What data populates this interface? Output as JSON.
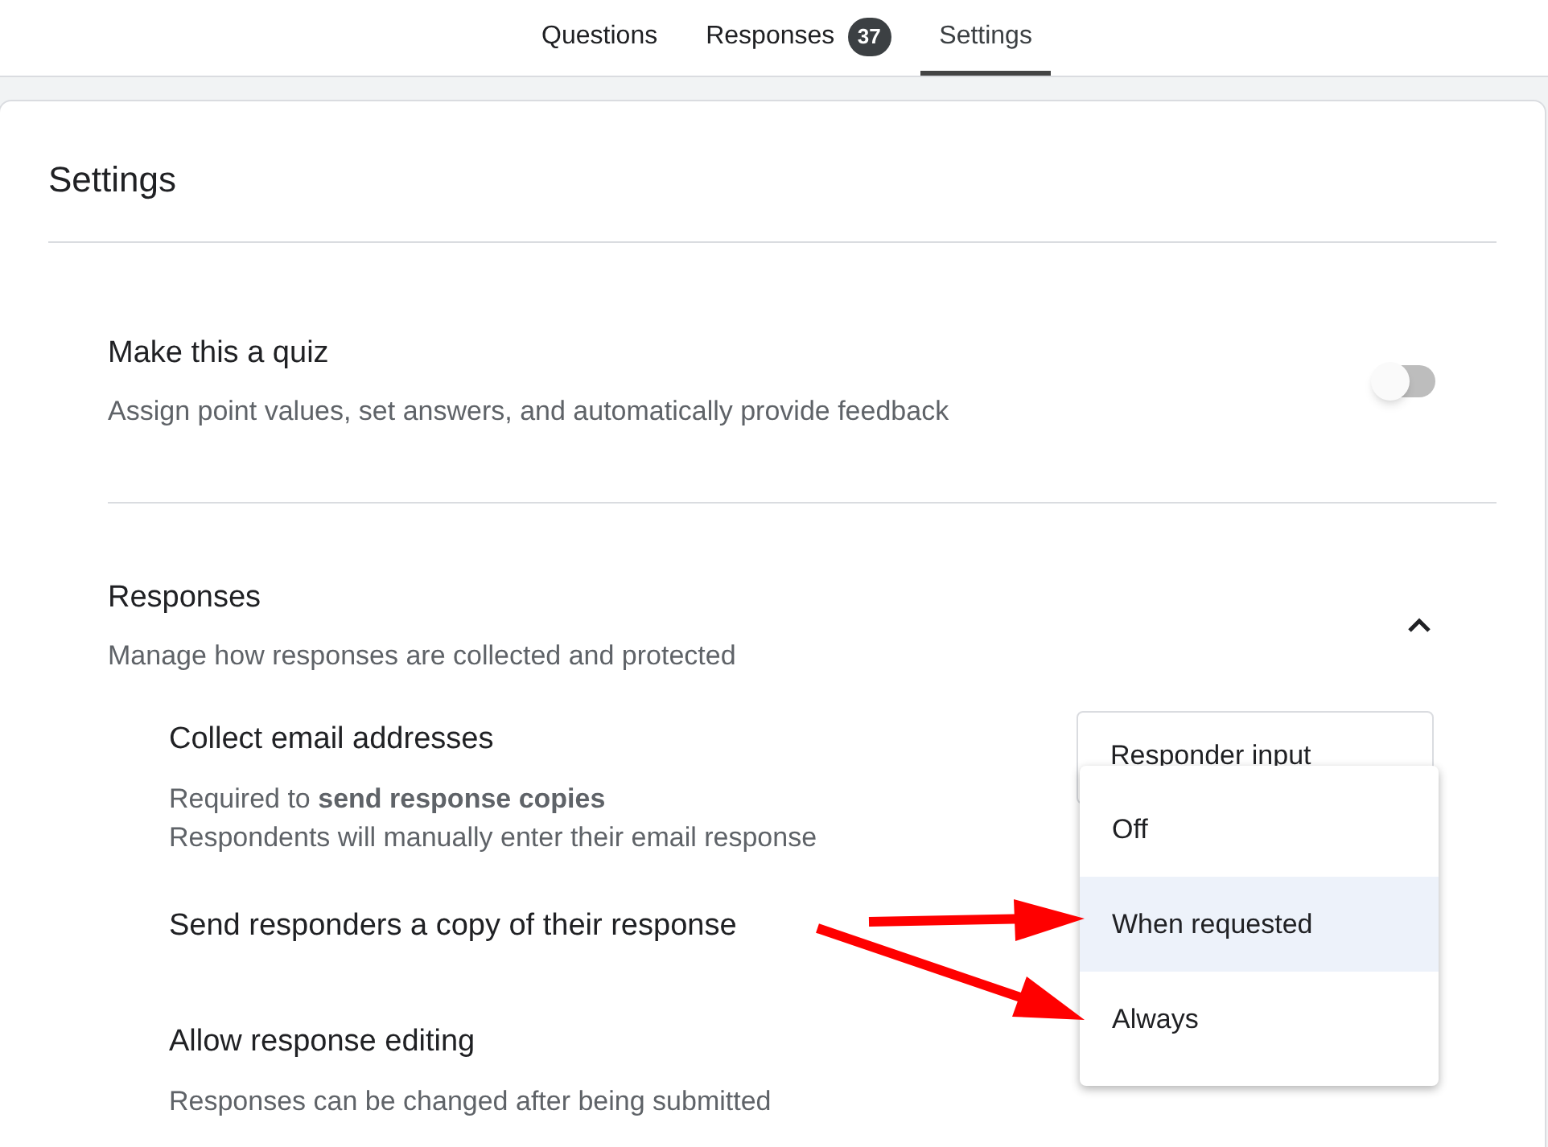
{
  "tabs": [
    {
      "label": "Questions",
      "selected": false
    },
    {
      "label": "Responses",
      "selected": false,
      "badge": "37"
    },
    {
      "label": "Settings",
      "selected": true
    }
  ],
  "settings": {
    "title": "Settings",
    "quiz": {
      "title": "Make this a quiz",
      "description": "Assign point values, set answers, and automatically provide feedback",
      "on": false
    },
    "responses": {
      "title": "Responses",
      "description": "Manage how responses are collected and protected",
      "expanded": true,
      "items": [
        {
          "title": "Collect email addresses",
          "description": [
            "Required to **send response copies**",
            "Respondents will manually enter their email response"
          ],
          "dropdown": {
            "value": "Responder input"
          }
        },
        {
          "title": "Send responders a copy of their response"
        },
        {
          "title": "Allow response editing",
          "description": [
            "Responses can be changed after being submitted"
          ]
        }
      ]
    }
  },
  "menu": {
    "options": [
      {
        "label": "Off",
        "selected": false
      },
      {
        "label": "When requested",
        "selected": true
      },
      {
        "label": "Always",
        "selected": false
      }
    ]
  }
}
